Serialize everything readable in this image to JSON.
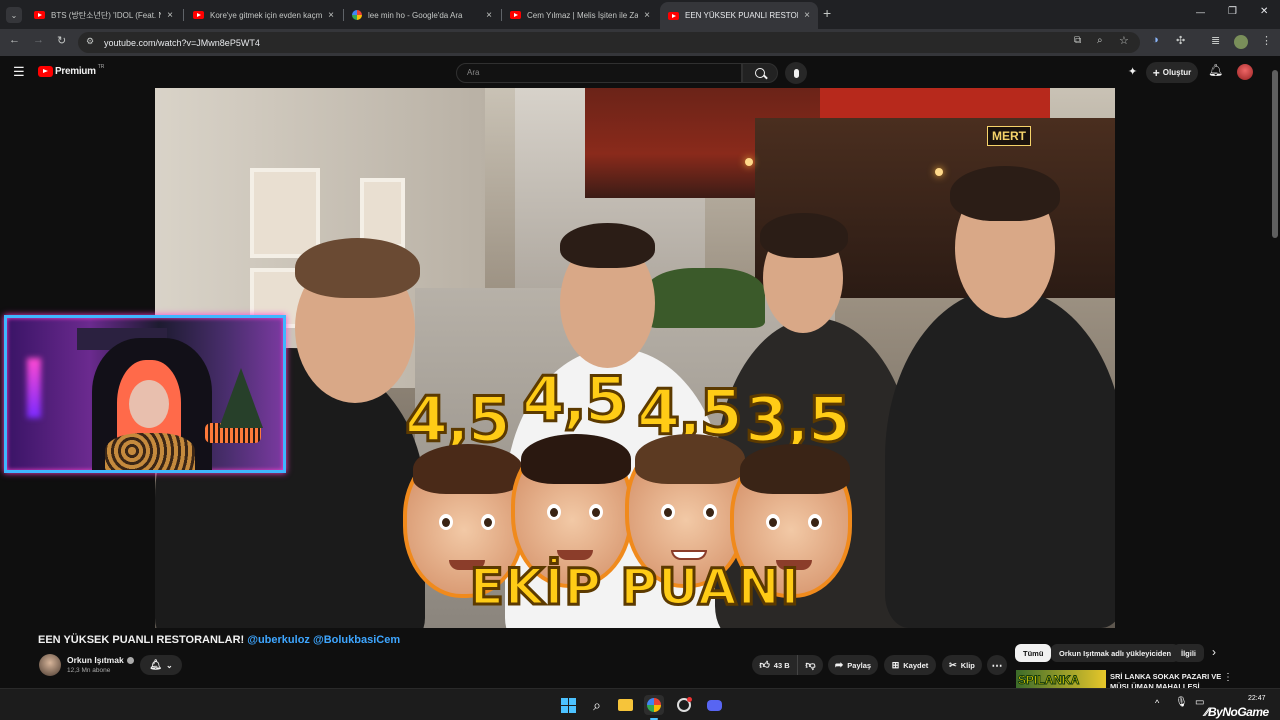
{
  "browser": {
    "tabs": [
      {
        "title": "BTS (방탄소년단) 'IDOL (Feat. N",
        "favicon": "youtube-icon"
      },
      {
        "title": "Kore'ye gitmek için evden kaçm",
        "favicon": "youtube-icon"
      },
      {
        "title": "lee min ho - Google'da Ara",
        "favicon": "google-icon"
      },
      {
        "title": "Cem Yılmaz | Melis İşiten ile Za",
        "favicon": "youtube-icon"
      },
      {
        "title": "EEN YÜKSEK PUANLI RESTORAN",
        "favicon": "youtube-icon",
        "active": true
      }
    ],
    "new_tab": "+",
    "close_glyph": "×",
    "url": "youtube.com/watch?v=JMwn8eP5WT4",
    "window_controls": {
      "minimize": "—",
      "restore": "❐",
      "close": "✕"
    }
  },
  "youtube": {
    "logo_text": "Premium",
    "logo_badge": "TR",
    "search_placeholder": "Ara",
    "create_label": "Oluştur"
  },
  "video": {
    "scores": [
      "4,5",
      "4,5",
      "4,5",
      "3,5"
    ],
    "overlay_caption": "EKİP PUANI",
    "sign_text": "MERT"
  },
  "video_info": {
    "title_main": "EEN YÜKSEK PUANLI RESTORANLAR!",
    "title_tags": "@uberkuloz @BolukbasiCem",
    "channel_name": "Orkun Işıtmak",
    "subscribers": "12,3 Mn abone",
    "like_count": "43 B",
    "share_label": "Paylaş",
    "save_label": "Kaydet",
    "clip_label": "Klip",
    "more_label": "⋯"
  },
  "recommendations": {
    "chips": [
      "Tümü",
      "Orkun Işıtmak adlı yükleyiciden",
      "İlgili"
    ],
    "first_title_line1": "SRİ LANKA SOKAK PAZARI VE",
    "first_title_line2": "MÜSLÜMAN MAHALLESİ",
    "thumb_text": "SPILANKA"
  },
  "taskbar": {
    "time": "22:47",
    "watermark": "ByNoGame",
    "tray_expand": "^"
  }
}
